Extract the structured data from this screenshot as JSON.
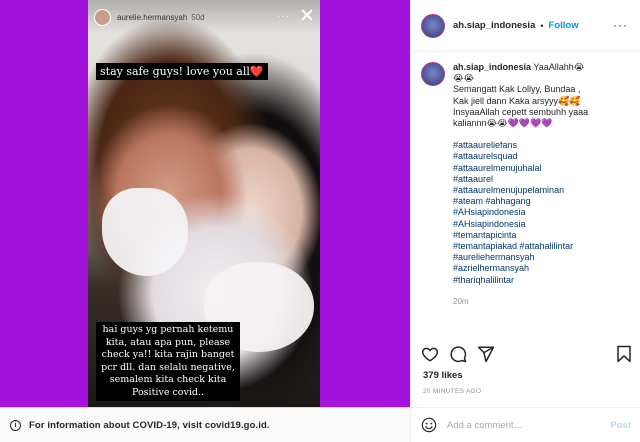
{
  "story": {
    "username": "aurelie.hermansyah",
    "time": "50d",
    "more_label": "···",
    "caption_top": "stay safe guys! love you all",
    "caption_top_heart": "❤️",
    "caption_bottom_lines": [
      "hai guys yg pernah ketemu",
      "kita, atau apa pun, please",
      "check ya!! kita rajin banget",
      "pcr dll. dan selalu negative,",
      "semalem kita check kita",
      "Positive covid.."
    ]
  },
  "covid_bar": {
    "text": "For information about COVID-19, visit covid19.go.id."
  },
  "post": {
    "username": "ah.siap_indonesia",
    "separator": "•",
    "follow_label": "Follow",
    "more_label": "···",
    "caption_lines": [
      "YaaAllahh😭",
      "😭😭",
      "Semangatt Kak Lollyy, Bundaa ,",
      "Kak jiell dann Kaka arsyyy🥰🥰",
      "InsyaaAllah cepett sembuhh yaaa",
      "kaliannn😭😭💜💜💜💜"
    ],
    "hashtags": [
      "#attaaureliefans",
      "#attaaurelsquad",
      "#attaaurelmenujuhalal",
      "#attaaurel",
      "#attaaurelmenujupelaminan",
      "#ateam #ahhagang",
      "#AHsiapindonesia",
      "#AHsiapindonesia",
      "#temantapicinta",
      "#temantapiakad #attahalilintar",
      "#aureliehermansyah",
      "#azrielhermansyah",
      "#thariqhalilintar"
    ],
    "comment_time": "20m",
    "likes": "379 likes",
    "posted_ago": "20 MINUTES AGO",
    "comment_placeholder": "Add a comment…",
    "post_label": "Post"
  },
  "colors": {
    "background": "#9b0fd6",
    "follow": "#0095f6",
    "hashtag": "#00376b"
  }
}
